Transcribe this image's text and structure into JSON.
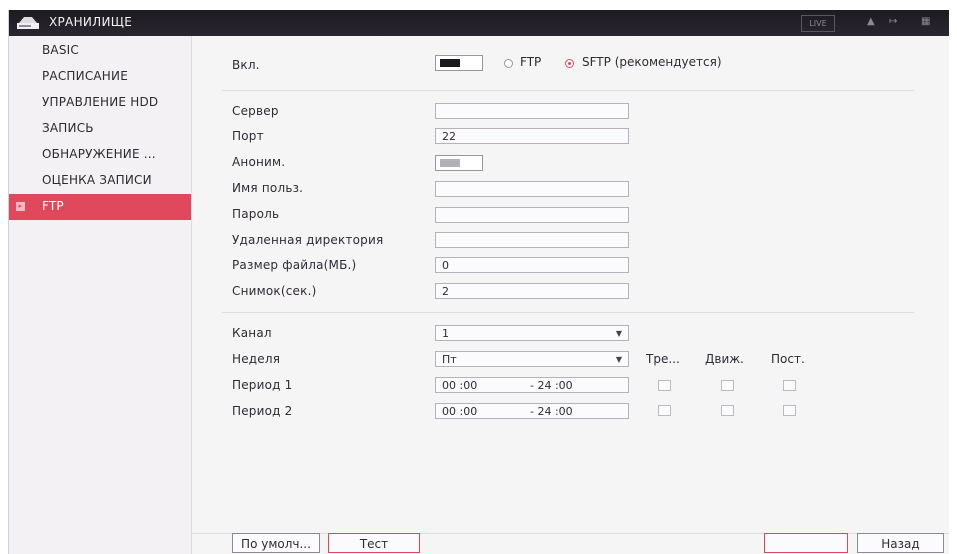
{
  "header": {
    "title": "ХРАНИЛИЩЕ",
    "live_label": "LIVE"
  },
  "sidebar": {
    "items": [
      {
        "label": "BASIC"
      },
      {
        "label": "РАСПИСАНИЕ"
      },
      {
        "label": "УПРАВЛЕНИЕ HDD"
      },
      {
        "label": "ЗАПИСЬ"
      },
      {
        "label": "ОБНАРУЖЕНИЕ ..."
      },
      {
        "label": "ОЦЕНКА ЗАПИСИ"
      },
      {
        "label": "FTP",
        "active": true
      }
    ]
  },
  "form": {
    "enable_label": "Вкл.",
    "ftp_label": "FTP",
    "sftp_label": "SFTP (рекомендуется)",
    "server_label": "Сервер",
    "server_value": "",
    "port_label": "Порт",
    "port_value": "22",
    "anon_label": "Аноним.",
    "user_label": "Имя польз.",
    "user_value": "",
    "password_label": "Пароль",
    "password_value": "",
    "remote_dir_label": "Удаленная директория",
    "remote_dir_value": "",
    "file_size_label": "Размер файла(МБ.)",
    "file_size_value": "0",
    "snapshot_label": "Снимок(сек.)",
    "snapshot_value": "2",
    "channel_label": "Канал",
    "channel_value": "1",
    "week_label": "Неделя",
    "week_value": "Пт",
    "col_alarm": "Тре...",
    "col_motion": "Движ.",
    "col_regular": "Пост.",
    "periods": [
      {
        "label": "Период 1",
        "start": "00 :00",
        "end": "- 24 :00"
      },
      {
        "label": "Период 2",
        "start": "00 :00",
        "end": "- 24 :00"
      }
    ]
  },
  "footer": {
    "default_label": "По умолч...",
    "test_label": "Тест",
    "back_label": "Назад"
  },
  "colors": {
    "accent": "#e0485c",
    "topbar": "#221f27"
  }
}
